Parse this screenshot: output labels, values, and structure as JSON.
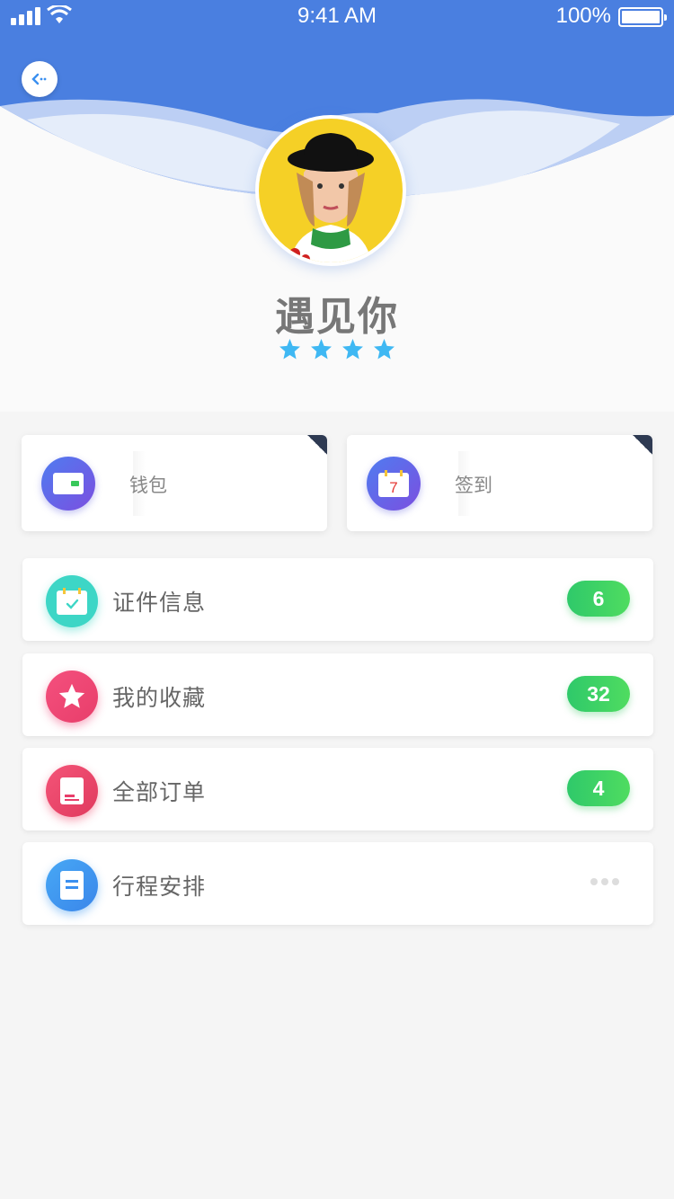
{
  "status_bar": {
    "time": "9:41 AM",
    "battery": "100%"
  },
  "profile": {
    "name": "遇见你",
    "rating": 4
  },
  "quick_cards": [
    {
      "label": "钱包",
      "icon": "wallet-icon"
    },
    {
      "label": "签到",
      "icon": "calendar-icon",
      "day": "7"
    }
  ],
  "menu": [
    {
      "label": "证件信息",
      "icon": "id-card-icon",
      "badge": "6",
      "color": "#3dd6c6"
    },
    {
      "label": "我的收藏",
      "icon": "star-icon",
      "badge": "32",
      "color": "#f0487a"
    },
    {
      "label": "全部订单",
      "icon": "order-icon",
      "badge": "4",
      "color": "#f0476a"
    },
    {
      "label": "行程安排",
      "icon": "schedule-icon",
      "color": "#3f9af0"
    }
  ],
  "colors": {
    "primary": "#4a7fe0",
    "badge": "#35cc66"
  }
}
